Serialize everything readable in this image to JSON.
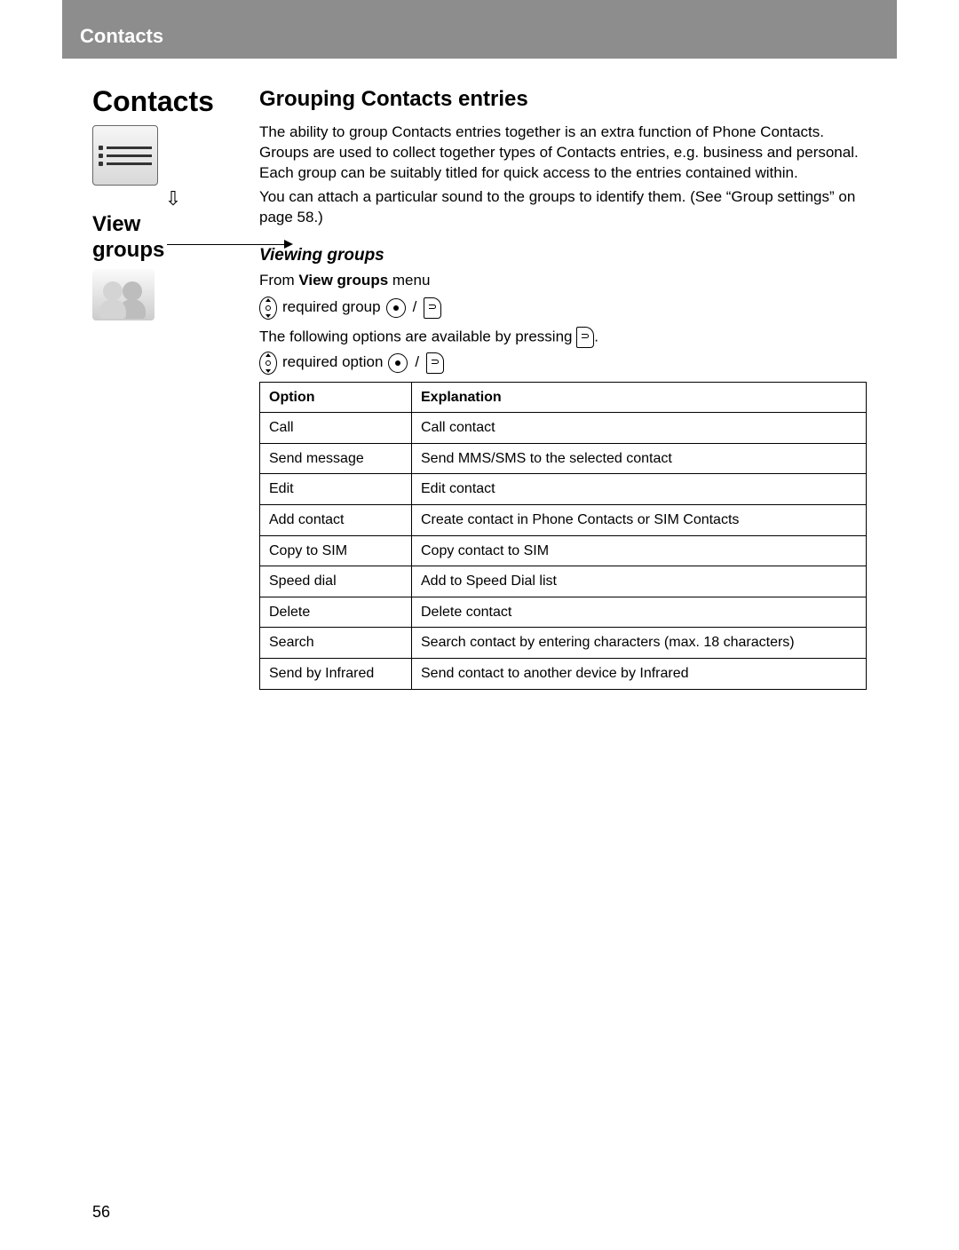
{
  "header": {
    "breadcrumb": "Contacts"
  },
  "sidebar": {
    "title": "Contacts",
    "subtitle_line1": "View",
    "subtitle_line2": "groups"
  },
  "main": {
    "section_title": "Grouping Contacts entries",
    "para1": "The ability to group Contacts entries together is an extra function of Phone Contacts. Groups are used to collect together types of Contacts entries, e.g. business and personal. Each group can be suitably titled for quick access to the entries contained within.",
    "para2": "You can attach a particular sound to the groups to identify them. (See “Group settings” on page 58.)",
    "subhead": "Viewing groups",
    "from_prefix": "From ",
    "from_bold": "View groups",
    "from_suffix": " menu",
    "nav_line1": "required group",
    "options_intro_prefix": "The following options are available by pressing ",
    "options_intro_suffix": ".",
    "nav_line2": "required option",
    "table": {
      "head_option": "Option",
      "head_explanation": "Explanation",
      "rows": [
        {
          "option": "Call",
          "explanation": "Call contact"
        },
        {
          "option": "Send message",
          "explanation": "Send MMS/SMS to the selected contact"
        },
        {
          "option": "Edit",
          "explanation": "Edit contact"
        },
        {
          "option": "Add contact",
          "explanation": "Create contact in Phone Contacts or SIM Contacts"
        },
        {
          "option": "Copy to SIM",
          "explanation": "Copy contact to SIM"
        },
        {
          "option": "Speed dial",
          "explanation": "Add to Speed Dial list"
        },
        {
          "option": "Delete",
          "explanation": "Delete contact"
        },
        {
          "option": "Search",
          "explanation": "Search contact by entering characters (max. 18 characters)"
        },
        {
          "option": "Send by Infrared",
          "explanation": "Send contact to another device by Infrared"
        }
      ]
    }
  },
  "page_number": "56"
}
